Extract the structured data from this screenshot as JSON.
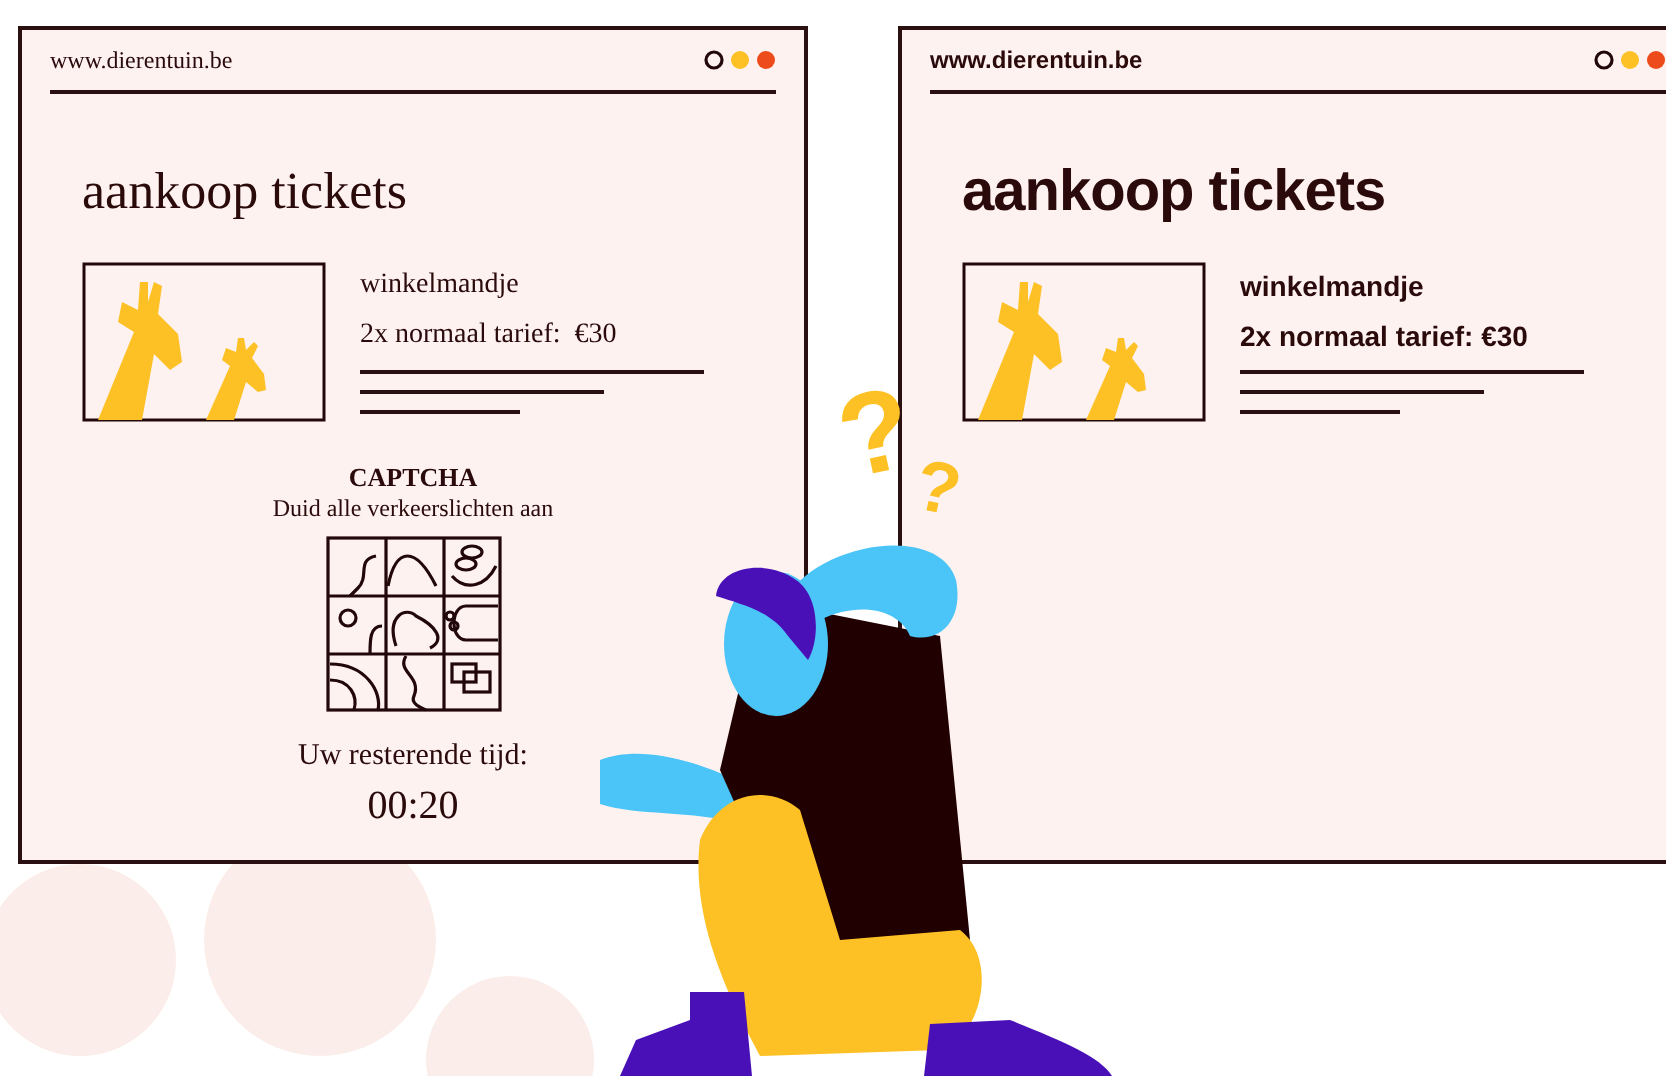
{
  "windows": [
    {
      "kind": "serif",
      "url": "www.dierentuin.be",
      "title": "aankoop tickets",
      "cart_heading": "winkelmandje",
      "cart_line": "2x normaal tarief:  €30",
      "captcha": {
        "title": "CAPTCHA",
        "instruction": "Duid alle verkeerslichten aan"
      },
      "timer": {
        "label": "Uw resterende tijd:",
        "value": "00:20"
      }
    },
    {
      "kind": "sans",
      "url": "www.dierentuin.be",
      "title": "aankoop tickets",
      "cart_heading": "winkelmandje",
      "cart_line": "2x normaal tarief: €30"
    }
  ],
  "question_marks": [
    "?",
    "?"
  ]
}
